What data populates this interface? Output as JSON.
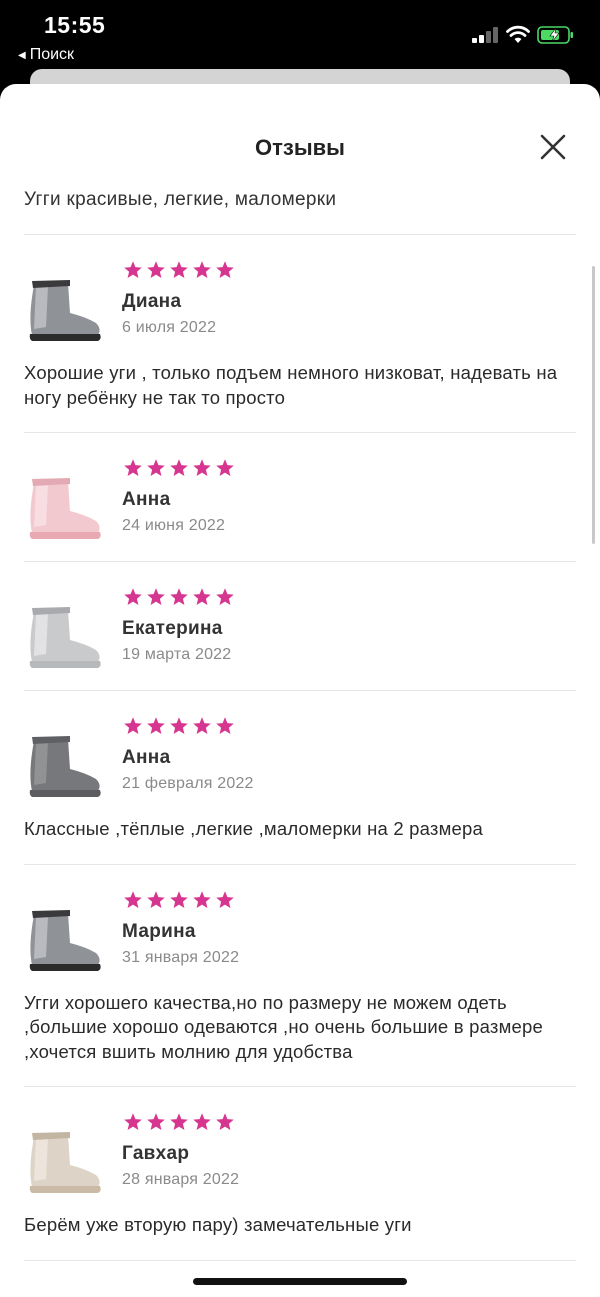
{
  "status": {
    "time": "15:55",
    "back_label": "Поиск"
  },
  "sheet": {
    "title": "Отзывы",
    "summary": "Угги красивые, легкие, маломерки"
  },
  "colors": {
    "star": "#d6368f",
    "accent_battery": "#4cd964"
  },
  "reviews": [
    {
      "name": "Диана",
      "date": "6 июля 2022",
      "rating": 5,
      "text": "Хорошие уги , только подъем немного низковат, надевать на ногу ребёнку не так то просто",
      "thumb": "black-glitter-boot"
    },
    {
      "name": "Анна",
      "date": "24 июня 2022",
      "rating": 5,
      "text": "",
      "thumb": "pink-boot"
    },
    {
      "name": "Екатерина",
      "date": "19 марта 2022",
      "rating": 5,
      "text": "",
      "thumb": "silver-boot"
    },
    {
      "name": "Анна",
      "date": "21 февраля 2022",
      "rating": 5,
      "text": "Классные ,тёплые ,легкие ,маломерки на 2 размера",
      "thumb": "grey-boot"
    },
    {
      "name": "Марина",
      "date": "31 января 2022",
      "rating": 5,
      "text": "Угги  хорошего качества,но по размеру не можем одеть ,большие  хорошо одеваются ,но очень большие в размере ,хочется вшить молнию для удобства",
      "thumb": "black-glitter-boot"
    },
    {
      "name": "Гавхар",
      "date": "28 января 2022",
      "rating": 5,
      "text": "Берём уже вторую пару) замечательные уги",
      "thumb": "beige-boot"
    }
  ]
}
